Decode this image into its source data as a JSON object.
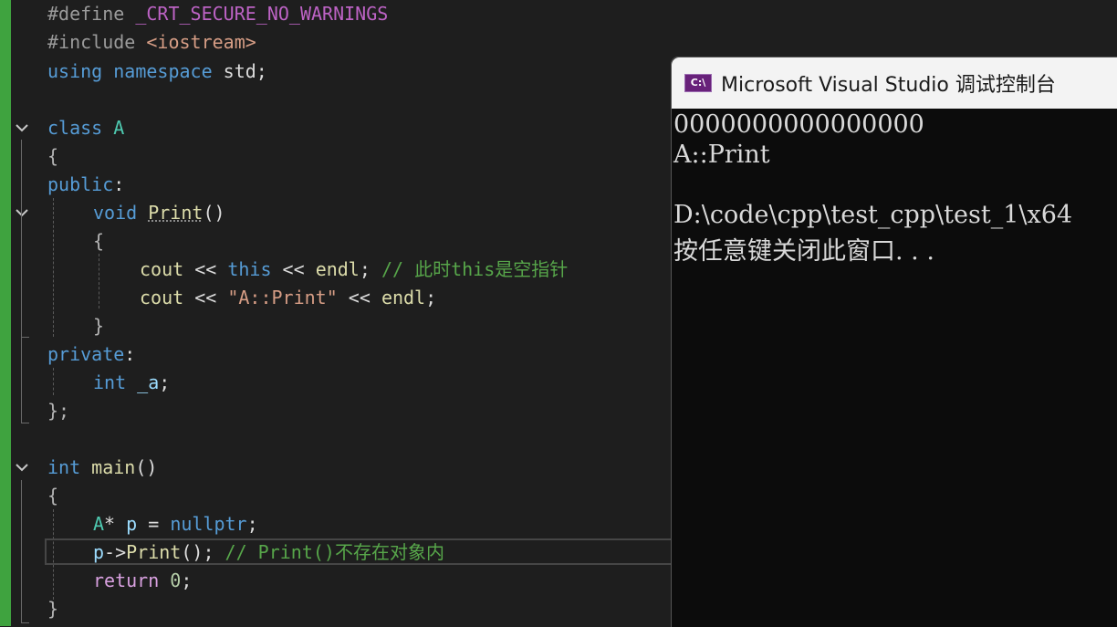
{
  "editor": {
    "lines": {
      "l1": {
        "a": "#define ",
        "b": "_CRT_SECURE_NO_WARNINGS"
      },
      "l2": {
        "a": "#include ",
        "b": "<iostream>"
      },
      "l3": {
        "a": "using",
        "b": " ",
        "c": "namespace",
        "d": " std;"
      },
      "l5": {
        "a": "class",
        "b": " ",
        "c": "A"
      },
      "l6": {
        "a": "{"
      },
      "l7": {
        "a": "public",
        "b": ":"
      },
      "l8": {
        "a": "void",
        "b": " ",
        "c": "Print",
        "d": "()"
      },
      "l9": {
        "a": "{"
      },
      "l10": {
        "a": "cout",
        "b": " << ",
        "c": "this",
        "d": " << ",
        "e": "endl",
        "f": "; ",
        "g": "// 此时this是空指针"
      },
      "l11": {
        "a": "cout",
        "b": " << ",
        "c": "\"A::Print\"",
        "d": " << ",
        "e": "endl",
        "f": ";"
      },
      "l12": {
        "a": "}"
      },
      "l13": {
        "a": "private",
        "b": ":"
      },
      "l14": {
        "a": "int",
        "b": " ",
        "c": "_a",
        "d": ";"
      },
      "l15": {
        "a": "};"
      },
      "l17": {
        "a": "int",
        "b": " ",
        "c": "main",
        "d": "()"
      },
      "l18": {
        "a": "{"
      },
      "l19": {
        "a": "A",
        "b": "* ",
        "c": "p",
        "d": " = ",
        "e": "nullptr",
        "f": ";"
      },
      "l20": {
        "a": "p",
        "b": "->",
        "c": "Print",
        "d": "(); ",
        "e": "// Print()不存在对象内"
      },
      "l21": {
        "a": "return",
        "b": " ",
        "c": "0",
        "d": ";"
      },
      "l22": {
        "a": "}"
      }
    }
  },
  "console": {
    "icon_text": "C:\\",
    "title": "Microsoft Visual Studio 调试控制台",
    "output": [
      "0000000000000000",
      "A::Print",
      "",
      "D:\\code\\cpp\\test_cpp\\test_1\\x64",
      "按任意键关闭此窗口. . ."
    ]
  },
  "colors": {
    "background": "#1e1e1e",
    "keyword": "#569cd6",
    "type": "#4ec9b0",
    "function": "#dcdcaa",
    "comment": "#57a64a",
    "change_bar": "#3fa33f"
  }
}
